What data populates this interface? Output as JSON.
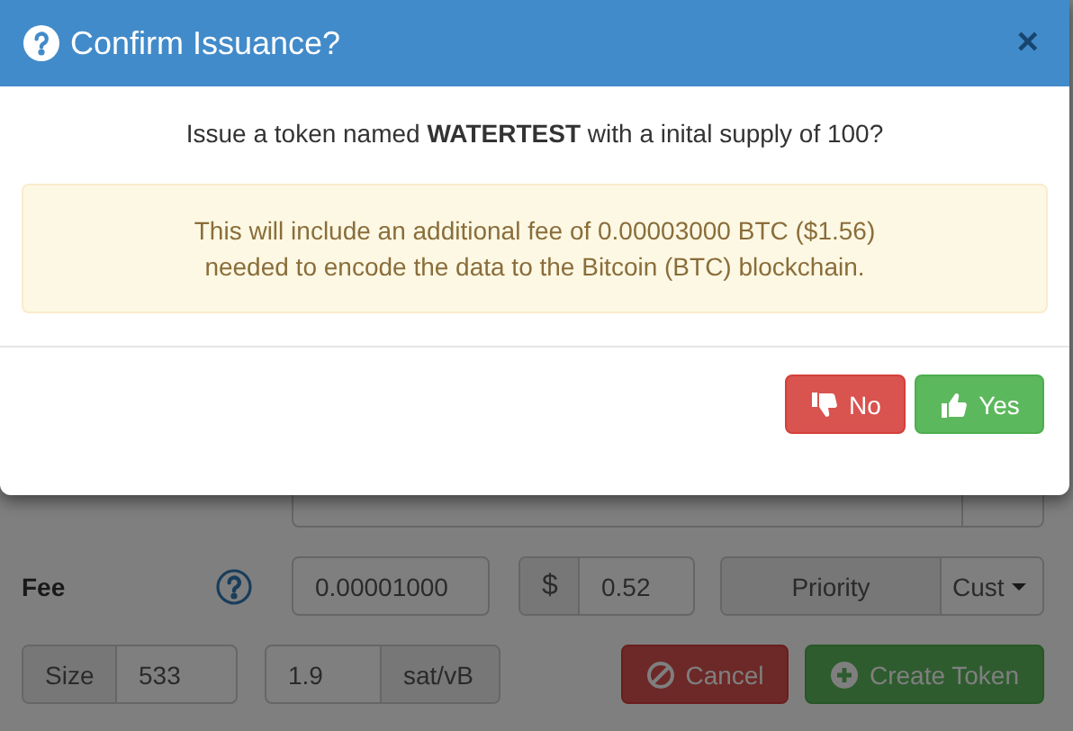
{
  "dialog": {
    "title": "Confirm Issuance?",
    "close": "×",
    "message": "Issue a token named **WATERTEST** with a inital supply of 100?",
    "notice": [
      "This will include an additional fee of 0.00003000 BTC ($1.56)",
      "needed to encode the data to the Bitcoin (BTC) blockchain."
    ],
    "buttons": [
      {
        "label": "No",
        "kind": "no"
      },
      {
        "label": "Yes",
        "kind": "yes"
      }
    ]
  },
  "form": {
    "fee": {
      "label": "Fee",
      "value": "0.00001000",
      "currency_symbol": "$",
      "usd": "0.52",
      "priority_label": "Priority",
      "priority_value": "Cust"
    },
    "size": {
      "label": "Size",
      "value": "533"
    },
    "rate": {
      "value": "1.9",
      "unit": "sat/vB"
    },
    "actions": [
      {
        "label": "Cancel",
        "kind": "cancel"
      },
      {
        "label": "Create Token",
        "kind": "create"
      }
    ]
  }
}
